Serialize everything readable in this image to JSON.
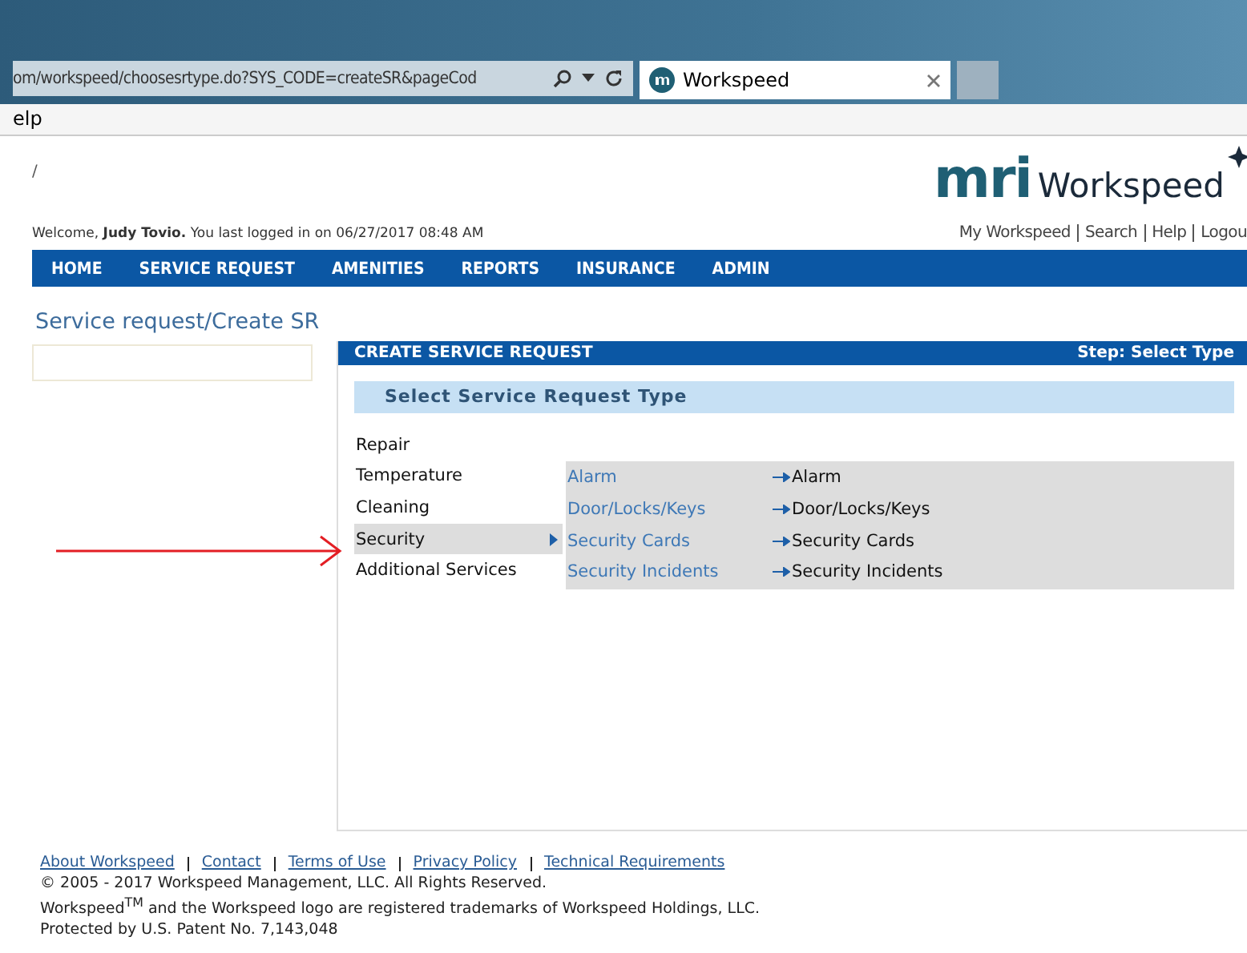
{
  "browser": {
    "address": "om/workspeed/choosesrtype.do?SYS_CODE=createSR&pageCod",
    "tab_title": "Workspeed",
    "menu_fragment": "elp"
  },
  "header": {
    "mark": "/",
    "logo_mark": "mri",
    "logo_text": "Workspeed",
    "welcome_prefix": "Welcome, ",
    "user": "Judy Tovio.",
    "welcome_suffix": " You last logged in on 06/27/2017 08:48 AM",
    "links": [
      "My Workspeed",
      "Search",
      "Help",
      "Logou"
    ]
  },
  "nav": [
    "HOME",
    "SERVICE REQUEST",
    "AMENITIES",
    "REPORTS",
    "INSURANCE",
    "ADMIN"
  ],
  "breadcrumb": "Service request/Create SR",
  "panel": {
    "title": "CREATE SERVICE REQUEST",
    "step": "Step: Select Type",
    "subtitle": "Select Service Request Type",
    "categories": [
      {
        "label": "Repair",
        "selected": false
      },
      {
        "label": "Temperature",
        "selected": false
      },
      {
        "label": "Cleaning",
        "selected": false
      },
      {
        "label": "Security",
        "selected": true
      },
      {
        "label": "Additional Services",
        "selected": false
      }
    ],
    "types": [
      {
        "label": "Alarm",
        "target": "Alarm"
      },
      {
        "label": "Door/Locks/Keys",
        "target": "Door/Locks/Keys"
      },
      {
        "label": "Security Cards",
        "target": "Security Cards"
      },
      {
        "label": "Security Incidents",
        "target": "Security Incidents"
      }
    ]
  },
  "footer": {
    "links": [
      "About Workspeed",
      "Contact",
      "Terms of Use",
      "Privacy Policy",
      "Technical Requirements"
    ],
    "lines": [
      "© 2005 - 2017 Workspeed Management, LLC. All Rights Reserved.",
      "Workspeed$^{TM}$ and the Workspeed logo are registered trademarks of Workspeed Holdings, LLC.",
      "Protected by U.S. Patent No. 7,143,048"
    ]
  }
}
